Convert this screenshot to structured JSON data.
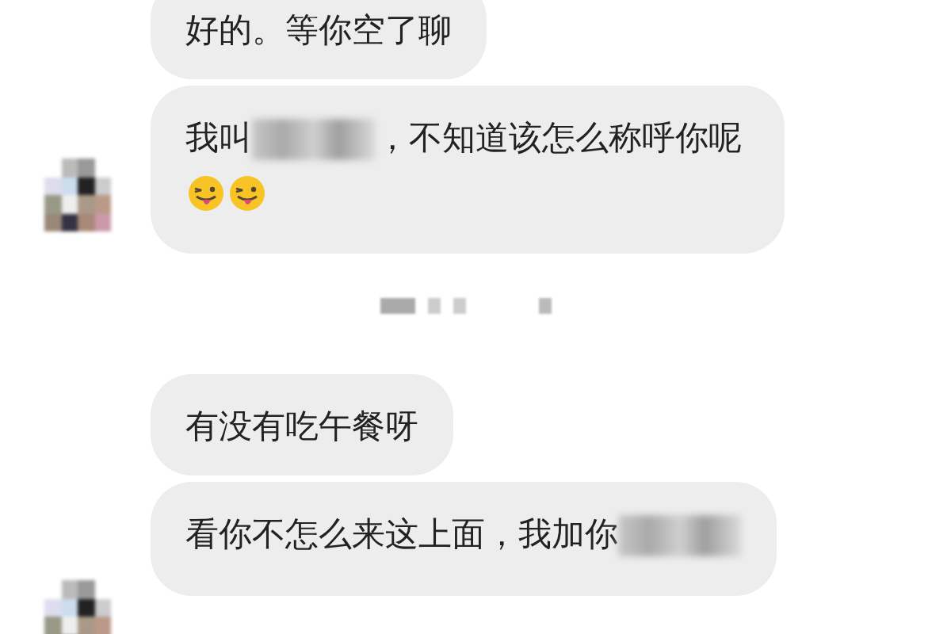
{
  "items": [
    {
      "kind": "group",
      "messages": [
        {
          "parts": [
            {
              "kind": "text",
              "text": "好的。等你空了聊"
            }
          ]
        },
        {
          "parts": [
            {
              "kind": "text",
              "text": "我叫"
            },
            {
              "kind": "redacted"
            },
            {
              "kind": "text",
              "text": "，不知道该怎么称呼你呢"
            },
            {
              "kind": "emoji"
            },
            {
              "kind": "emoji"
            }
          ]
        }
      ]
    },
    {
      "kind": "timestamp"
    },
    {
      "kind": "group",
      "messages": [
        {
          "parts": [
            {
              "kind": "text",
              "text": "有没有吃午餐呀"
            }
          ]
        },
        {
          "parts": [
            {
              "kind": "text",
              "text": "看你不怎么来这上面，我加你"
            },
            {
              "kind": "redacted"
            }
          ]
        }
      ]
    }
  ]
}
